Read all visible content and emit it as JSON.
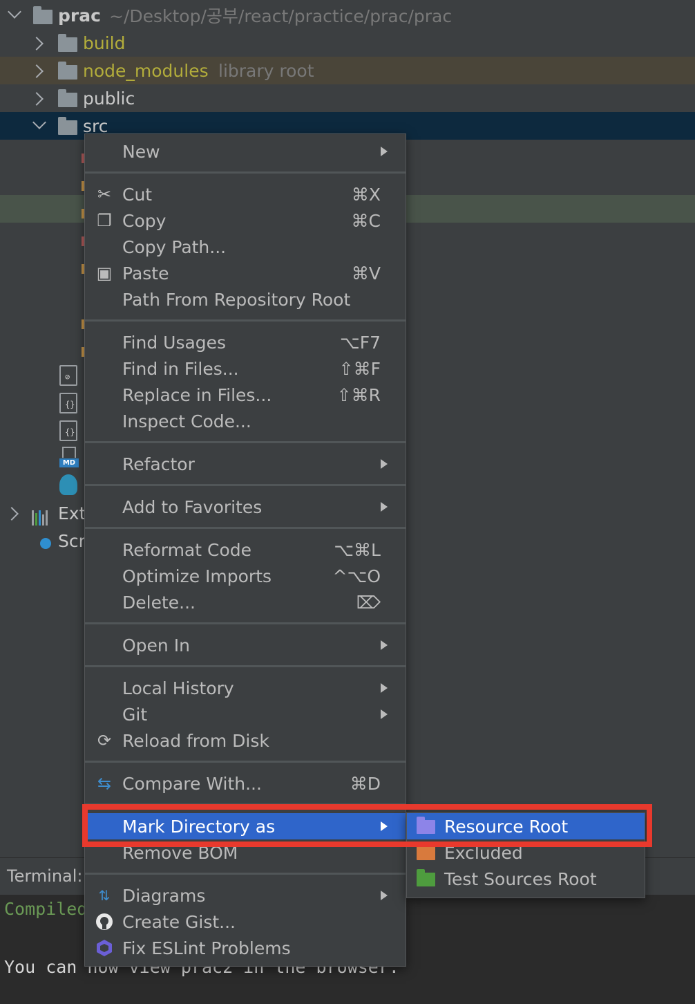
{
  "tree": {
    "root": {
      "name": "prac",
      "path": "~/Desktop/공부/react/practice/prac/prac"
    },
    "folders": [
      {
        "name": "build",
        "hint": ""
      },
      {
        "name": "node_modules",
        "hint": "library root"
      },
      {
        "name": "public",
        "hint": ""
      },
      {
        "name": "src",
        "hint": ""
      }
    ],
    "ext_label": "Ext",
    "scratch_label": "Scr"
  },
  "terminal": {
    "title": "Terminal:",
    "line1": "Compiled",
    "line2": "You can now view prac2 in the browser."
  },
  "menu": {
    "new": "New",
    "cut": "Cut",
    "cut_sc": "⌘X",
    "copy": "Copy",
    "copy_sc": "⌘C",
    "copy_path": "Copy Path...",
    "paste": "Paste",
    "paste_sc": "⌘V",
    "path_from_repo": "Path From Repository Root",
    "find_usages": "Find Usages",
    "find_usages_sc": "⌥F7",
    "find_in_files": "Find in Files...",
    "find_in_files_sc": "⇧⌘F",
    "replace_in_files": "Replace in Files...",
    "replace_in_files_sc": "⇧⌘R",
    "inspect_code": "Inspect Code...",
    "refactor": "Refactor",
    "add_to_favorites": "Add to Favorites",
    "reformat_code": "Reformat Code",
    "reformat_code_sc": "⌥⌘L",
    "optimize_imports": "Optimize Imports",
    "optimize_imports_sc": "^⌥O",
    "delete": "Delete...",
    "delete_sc": "⌦",
    "open_in": "Open In",
    "local_history": "Local History",
    "git": "Git",
    "reload_from_disk": "Reload from Disk",
    "compare_with": "Compare With...",
    "compare_with_sc": "⌘D",
    "mark_directory_as": "Mark Directory as",
    "remove_bom": "Remove BOM",
    "diagrams": "Diagrams",
    "create_gist": "Create Gist...",
    "fix_eslint": "Fix ESLint Problems"
  },
  "submenu": {
    "resource_root": "Resource Root",
    "excluded": "Excluded",
    "test_sources_root": "Test Sources Root"
  },
  "colors": {
    "highlight": "#2f65ca",
    "annotation": "#e8392d",
    "resource_folder": "#8d84e8",
    "excluded_folder": "#d87a3d",
    "test_folder": "#4e9c3e"
  }
}
